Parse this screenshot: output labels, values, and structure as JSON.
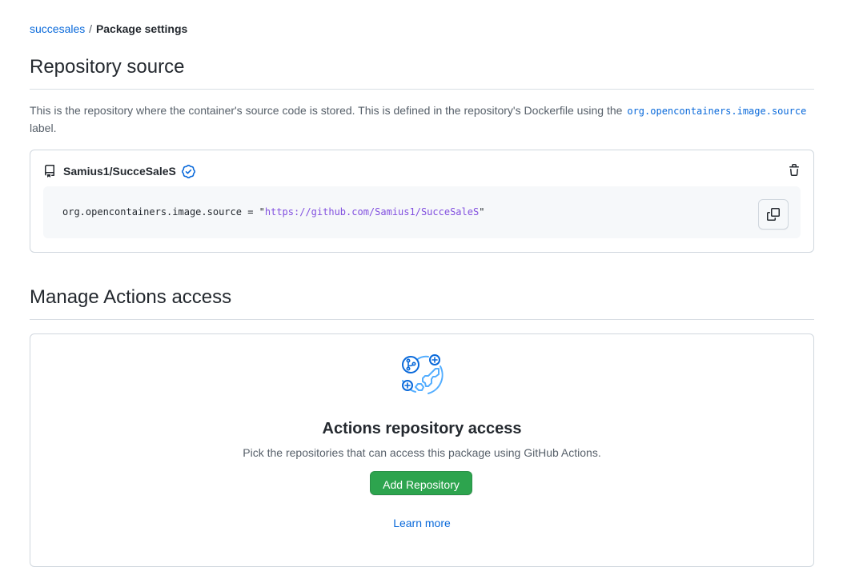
{
  "breadcrumb": {
    "owner": "succesales",
    "separator": "/",
    "current": "Package settings"
  },
  "repository_source": {
    "heading": "Repository source",
    "description_prefix": "This is the repository where the container's source code is stored. This is defined in the repository's Dockerfile using the",
    "description_code": "org.opencontainers.image.source",
    "description_suffix": "label.",
    "repo_icon": "repo-icon",
    "repo_name": "Samius1/SucceSaleS",
    "verified_icon": "verified-icon",
    "delete_icon": "trash-icon",
    "snippet_key": "org.opencontainers.image.source = ",
    "snippet_quote": "\"",
    "snippet_value": "https://github.com/Samius1/SucceSaleS",
    "copy_icon": "copy-icon"
  },
  "actions_access": {
    "heading": "Manage Actions access",
    "blank_icon": "actions-globe-illustration",
    "title": "Actions repository access",
    "description": "Pick the repositories that can access this package using GitHub Actions.",
    "button_label": "Add Repository",
    "learn_more": "Learn more"
  },
  "colors": {
    "link": "#0969da",
    "primary_button": "#2da44e",
    "verified": "#0969da",
    "string": "#8250df"
  }
}
